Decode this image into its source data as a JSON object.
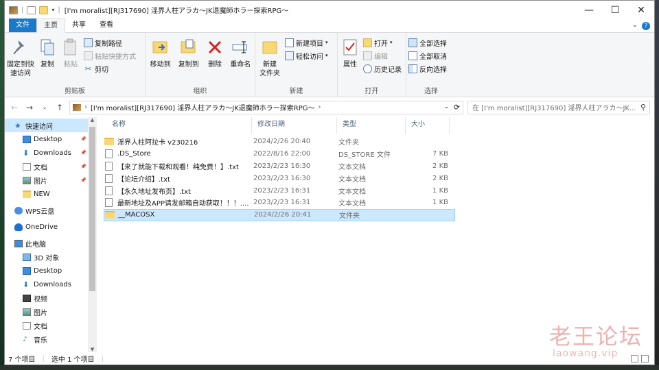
{
  "window": {
    "title": "[I'm moralist][RJ317690] 淫界人柱アラカ～JK退魔師ホラー探索RPG～",
    "controls": {
      "minimize": "—",
      "maximize": "☐",
      "close": "✕"
    }
  },
  "tabs": [
    {
      "label": "文件"
    },
    {
      "label": "主页"
    },
    {
      "label": "共享"
    },
    {
      "label": "查看"
    }
  ],
  "ribbon": {
    "clipboard": {
      "group_label": "剪贴板",
      "pin_quick_access": "固定到快\n速访问",
      "copy": "复制",
      "paste": "粘贴",
      "copy_path": "复制路径",
      "paste_shortcut": "粘贴快捷方式",
      "cut": "剪切"
    },
    "organize": {
      "group_label": "组织",
      "move_to": "移动到",
      "copy_to": "复制到",
      "delete": "删除",
      "rename": "重命名"
    },
    "new": {
      "group_label": "新建",
      "new_folder": "新建\n文件夹",
      "new_item": "新建项目",
      "easy_access": "轻松访问"
    },
    "open": {
      "group_label": "打开",
      "properties": "属性",
      "open": "打开",
      "edit": "编辑",
      "history": "历史记录"
    },
    "select": {
      "group_label": "选择",
      "select_all": "全部选择",
      "select_none": "全部取消",
      "invert": "反向选择"
    }
  },
  "navbar": {
    "address": "[I'm moralist][RJ317690] 淫界人柱アラカ～JK退魔師ホラー探索RPG～",
    "search_placeholder": "在 [I'm moralist][RJ317690] 淫界人柱アラカ～JK..."
  },
  "sidebar": {
    "items": [
      {
        "label": "快速访问",
        "icon": "star-icon",
        "pinned": false
      },
      {
        "label": "Desktop",
        "icon": "desktop-icon",
        "pinned": true
      },
      {
        "label": "Downloads",
        "icon": "download-icon",
        "pinned": true
      },
      {
        "label": "文档",
        "icon": "document-icon",
        "pinned": true
      },
      {
        "label": "图片",
        "icon": "picture-icon",
        "pinned": true
      },
      {
        "label": "NEW",
        "icon": "folder-icon",
        "pinned": false
      },
      {
        "label": "WPS云盘",
        "icon": "cloud-icon",
        "pinned": false
      },
      {
        "label": "OneDrive",
        "icon": "onedrive-icon",
        "pinned": false
      },
      {
        "label": "此电脑",
        "icon": "computer-icon",
        "pinned": false
      },
      {
        "label": "3D 对象",
        "icon": "cube-icon",
        "pinned": false
      },
      {
        "label": "Desktop",
        "icon": "desktop-icon",
        "pinned": false
      },
      {
        "label": "Downloads",
        "icon": "download-icon",
        "pinned": false
      },
      {
        "label": "视频",
        "icon": "video-icon",
        "pinned": false
      },
      {
        "label": "图片",
        "icon": "picture-icon",
        "pinned": false
      },
      {
        "label": "文档",
        "icon": "document-icon",
        "pinned": false
      },
      {
        "label": "音乐",
        "icon": "music-icon",
        "pinned": false
      }
    ]
  },
  "columns": [
    "名称",
    "修改日期",
    "类型",
    "大小"
  ],
  "files": [
    {
      "name": "淫界人柱阿拉卡 v230216",
      "date": "2024/2/26 20:40",
      "type": "文件夹",
      "size": "",
      "kind": "folder",
      "selected": false
    },
    {
      "name": ".DS_Store",
      "date": "2022/8/16 22:00",
      "type": "DS_STORE 文件",
      "size": "7 KB",
      "kind": "file",
      "selected": false
    },
    {
      "name": "【来了就能下载和观看！纯免费！】.txt",
      "date": "2023/2/23 16:30",
      "type": "文本文档",
      "size": "2 KB",
      "kind": "txt",
      "selected": false
    },
    {
      "name": "【论坛介绍】.txt",
      "date": "2023/2/23 16:30",
      "type": "文本文档",
      "size": "2 KB",
      "kind": "txt",
      "selected": false
    },
    {
      "name": "【永久地址发布页】.txt",
      "date": "2023/2/23 16:31",
      "type": "文本文档",
      "size": "1 KB",
      "kind": "txt",
      "selected": false
    },
    {
      "name": "最新地址及APP请发邮箱自动获取！！！....",
      "date": "2023/2/23 16:31",
      "type": "文本文档",
      "size": "1 KB",
      "kind": "txt",
      "selected": false
    },
    {
      "name": "__MACOSX",
      "date": "2024/2/26 20:41",
      "type": "文件夹",
      "size": "",
      "kind": "folder",
      "selected": true
    }
  ],
  "status": {
    "count": "7 个项目",
    "selected": "选中 1 个项目"
  },
  "watermark": {
    "cn": "老王论坛",
    "en": "laowang.vip"
  }
}
